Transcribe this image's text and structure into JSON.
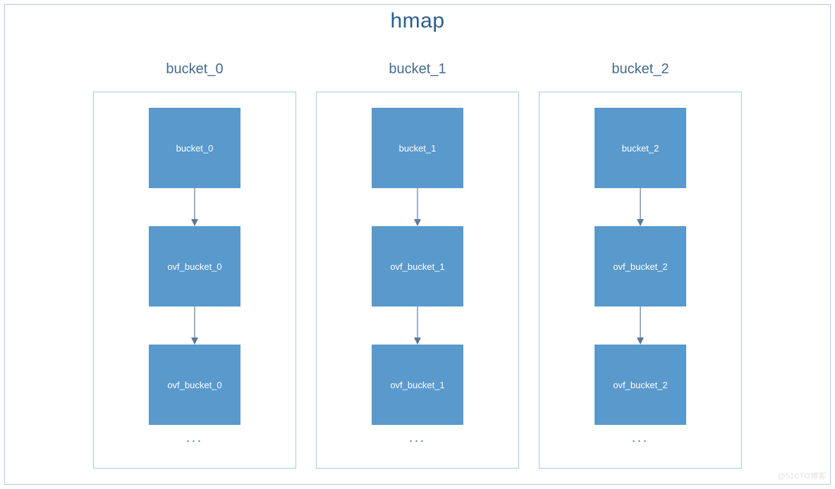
{
  "title": "hmap",
  "columns": [
    {
      "header": "bucket_0",
      "nodes": [
        "bucket_0",
        "ovf_bucket_0",
        "ovf_bucket_0"
      ],
      "ellipsis": "..."
    },
    {
      "header": "bucket_1",
      "nodes": [
        "bucket_1",
        "ovf_bucket_1",
        "ovf_bucket_1"
      ],
      "ellipsis": "..."
    },
    {
      "header": "bucket_2",
      "nodes": [
        "bucket_2",
        "ovf_bucket_2",
        "ovf_bucket_2"
      ],
      "ellipsis": "..."
    }
  ],
  "watermark": "@51CTO博客",
  "colors": {
    "node_fill": "#5a99cc",
    "border": "#a8c9e8",
    "title_text": "#2a5c8f",
    "label_text": "#456a8f"
  }
}
